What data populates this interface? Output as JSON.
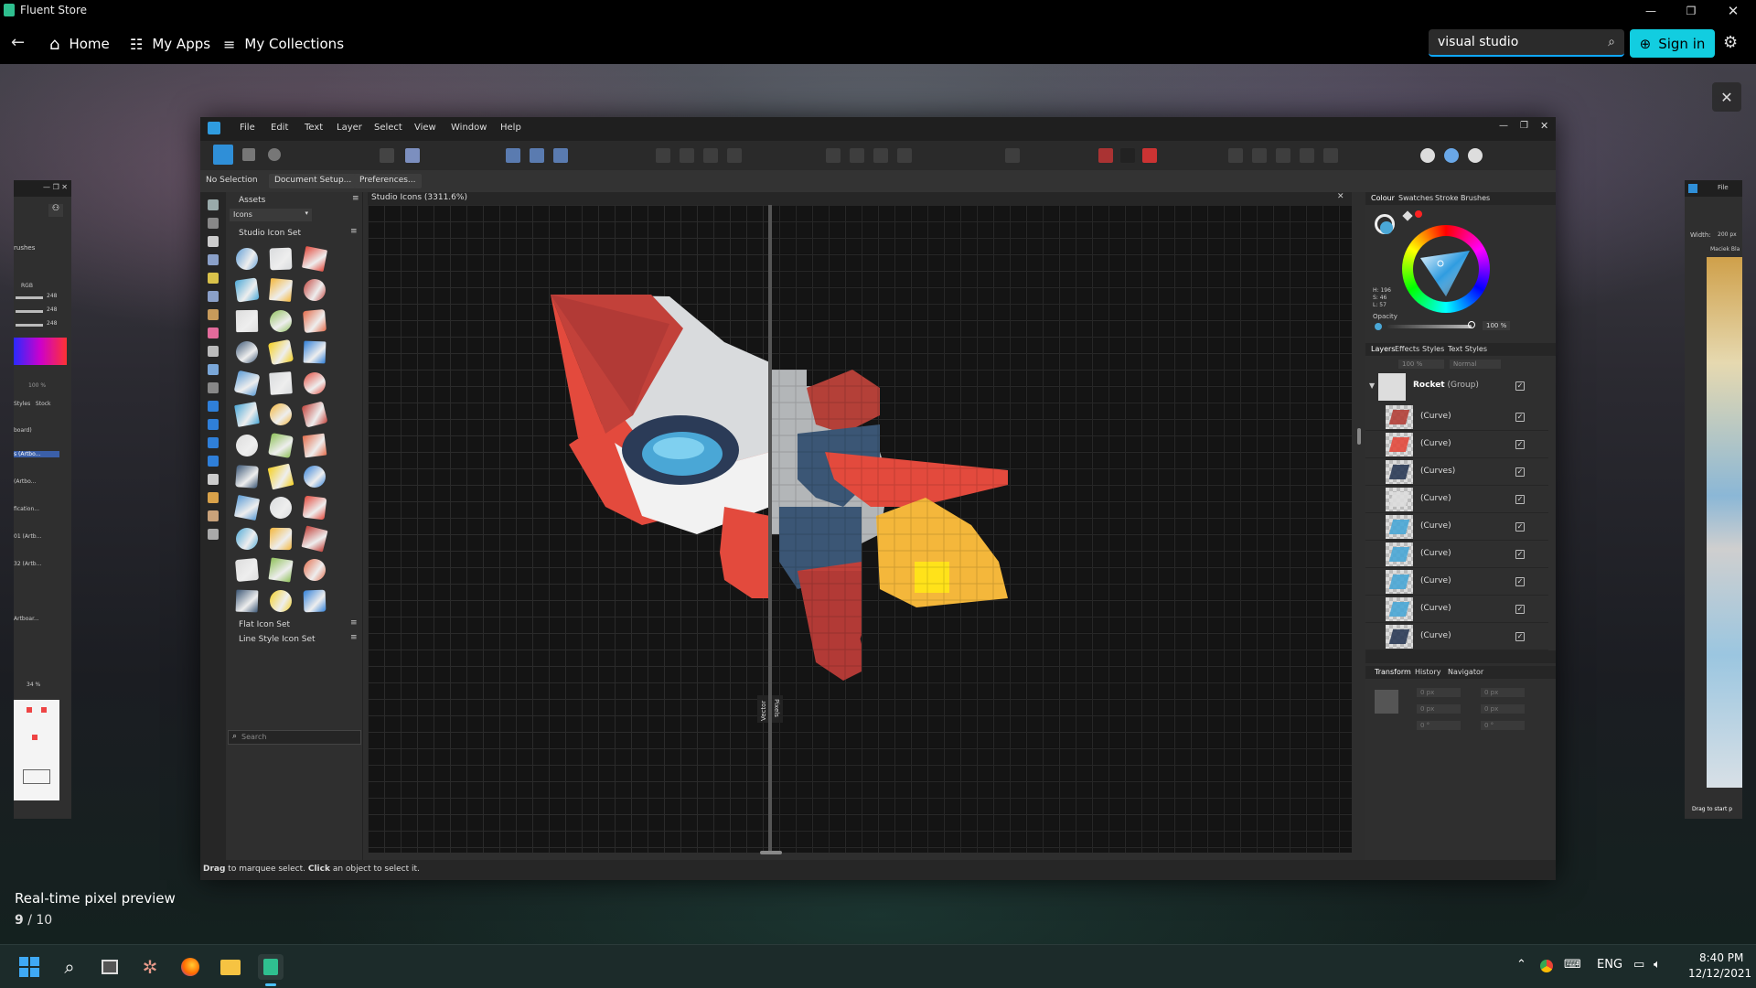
{
  "titlebar": {
    "app_title": "Fluent Store"
  },
  "nav": {
    "home": "Home",
    "my_apps": "My Apps",
    "my_collections": "My Collections",
    "search_value": "visual studio",
    "sign_in": "Sign in"
  },
  "gallery": {
    "caption": "Real-time pixel preview",
    "page_current": "9",
    "page_separator": " / ",
    "page_total": "10"
  },
  "app": {
    "menu": [
      "File",
      "Edit",
      "Text",
      "Layer",
      "Select",
      "View",
      "Window",
      "Help"
    ],
    "context": {
      "selection": "No Selection",
      "doc_setup": "Document Setup...",
      "preferences": "Preferences..."
    },
    "assets": {
      "tab": "Assets",
      "category": "Icons",
      "set1": "Studio Icon Set",
      "set2": "Flat Icon Set",
      "set3": "Line Style Icon Set",
      "search_placeholder": "Search"
    },
    "canvas": {
      "doc_tab": "Studio Icons (3311.6%)",
      "vector_label": "Vector",
      "pixel_label": "Pixels"
    },
    "colour": {
      "tabs": [
        "Colour",
        "Swatches",
        "Stroke",
        "Brushes"
      ],
      "h": "H: 196",
      "s": "S: 46",
      "l": "L: 57",
      "opacity_label": "Opacity",
      "opacity_value": "100 %"
    },
    "layers": {
      "tabs": [
        "Layers",
        "Effects",
        "Styles",
        "Text Styles"
      ],
      "opacity": "100 %",
      "blend": "Normal",
      "group_name": "Rocket",
      "group_type": "(Group)",
      "rows": [
        "(Curve)",
        "(Curve)",
        "(Curves)",
        "(Curve)",
        "(Curve)",
        "(Curve)",
        "(Curve)",
        "(Curve)",
        "(Curve)"
      ]
    },
    "transform": {
      "tabs": [
        "Transform",
        "History",
        "Navigator"
      ],
      "x": "0 px",
      "y": "0 px",
      "w": "0 px",
      "h": "0 px",
      "r": "0 °",
      "s": "0 °"
    },
    "status": {
      "drag_b": "Drag",
      "drag_t": " to marquee select. ",
      "click_b": "Click",
      "click_t": " an object to select it."
    }
  },
  "left_window": {
    "tab": "rushes",
    "mode": "RGB",
    "values": [
      "248",
      "248",
      "248"
    ],
    "zoom_value": "100 %",
    "tabs": "Styles   Stock",
    "layers": [
      "board)",
      "s (Artbo...",
      "(Artbo...",
      "fication...",
      "01 (Artb...",
      "32 (Artb...",
      "",
      "Artboar..."
    ],
    "page_zoom": "34 %"
  },
  "right_window": {
    "menu_file": "File",
    "width_label": "Width:",
    "width_value": "200 px",
    "layer_name": "Maciek Bla",
    "drag_hint": "Drag to start p"
  },
  "taskbar": {
    "lang": "ENG",
    "time": "8:40 PM",
    "date": "12/12/2021"
  }
}
